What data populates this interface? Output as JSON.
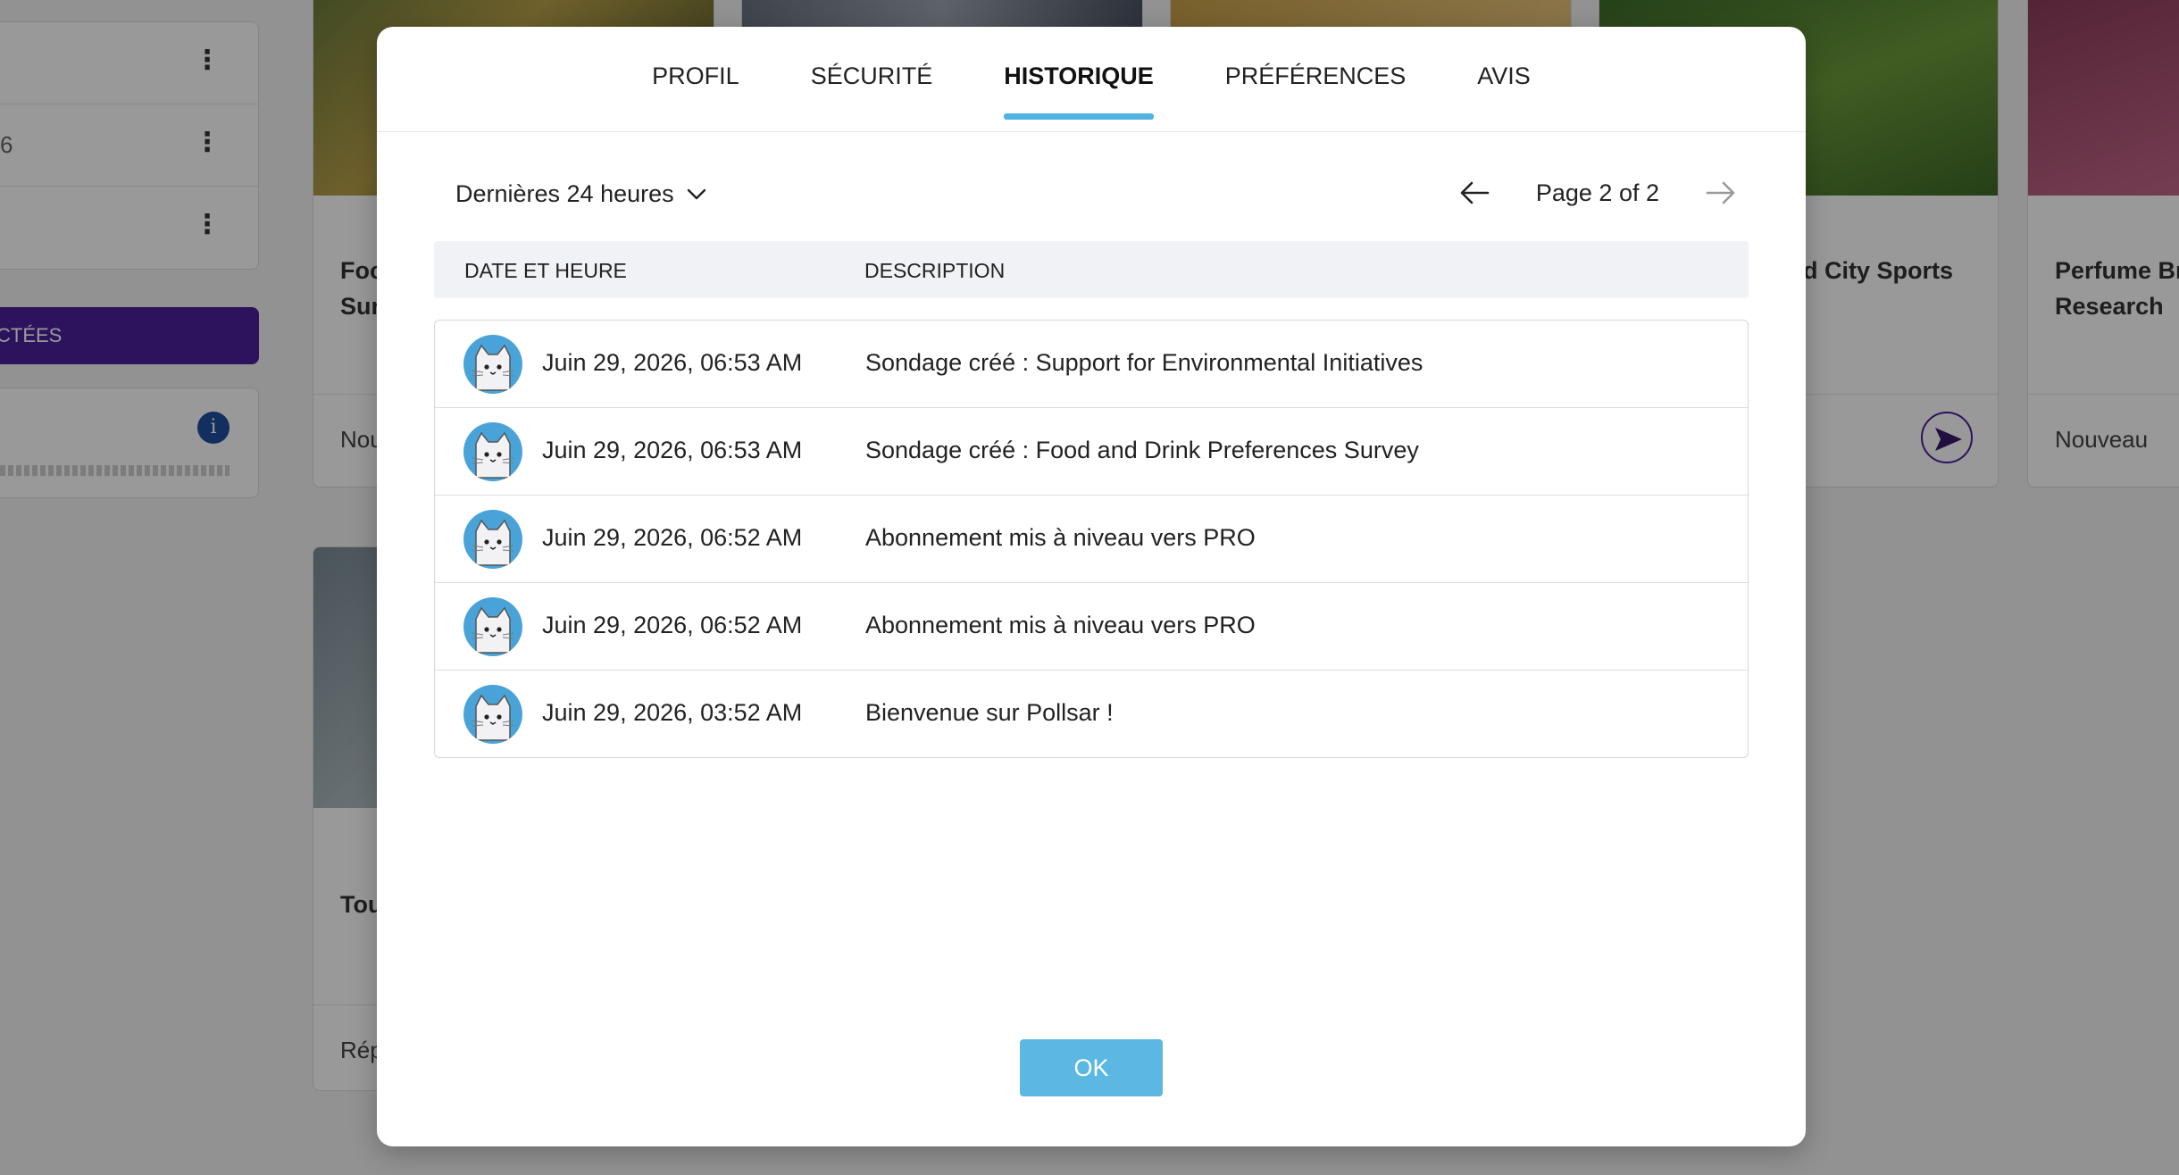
{
  "background": {
    "menu_fragment": "6",
    "left_button_label": "CTÉES",
    "cards": [
      {
        "title": "Foo\nSur",
        "footer": "Nou"
      },
      {
        "title": "d City Sports",
        "footer": ""
      },
      {
        "title": "Perfume Br\nResearch",
        "footer": "Nouveau"
      },
      {
        "title": "Tou",
        "footer": "Rép"
      }
    ]
  },
  "modal": {
    "tabs": [
      {
        "label": "PROFIL",
        "active": false
      },
      {
        "label": "SÉCURITÉ",
        "active": false
      },
      {
        "label": "HISTORIQUE",
        "active": true
      },
      {
        "label": "PRÉFÉRENCES",
        "active": false
      },
      {
        "label": "AVIS",
        "active": false
      }
    ],
    "filter": {
      "label": "Dernières 24 heures"
    },
    "pager": {
      "text": "Page 2 of 2"
    },
    "table": {
      "headers": {
        "datetime": "DATE ET HEURE",
        "description": "DESCRIPTION"
      },
      "rows": [
        {
          "datetime": "Juin 29, 2026, 06:53 AM",
          "description": "Sondage créé : Support for Environmental Initiatives"
        },
        {
          "datetime": "Juin 29, 2026, 06:53 AM",
          "description": "Sondage créé : Food and Drink Preferences Survey"
        },
        {
          "datetime": "Juin 29, 2026, 06:52 AM",
          "description": "Abonnement mis à niveau vers PRO"
        },
        {
          "datetime": "Juin 29, 2026, 06:52 AM",
          "description": "Abonnement mis à niveau vers PRO"
        },
        {
          "datetime": "Juin 29, 2026, 03:52 AM",
          "description": "Bienvenue sur Pollsar !"
        }
      ]
    },
    "ok_label": "OK"
  },
  "colors": {
    "accent": "#4fb3de",
    "ok_button": "#5bb8e2",
    "brand_purple": "#4b1e9b"
  },
  "icons": {
    "avatar": "cat-avatar-icon",
    "filter": "chevron-down-icon",
    "prev": "arrow-left-icon",
    "next": "arrow-right-icon",
    "menu": "more-vertical-icon",
    "info": "info-icon",
    "send": "send-icon"
  }
}
